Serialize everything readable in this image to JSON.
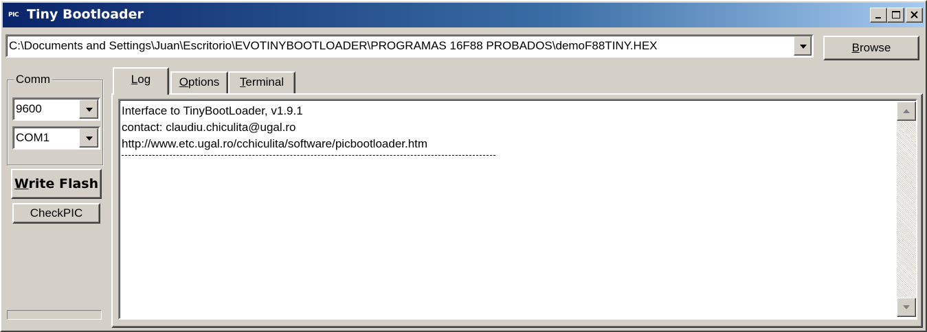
{
  "window": {
    "icon_text": "PIC",
    "title": "Tiny Bootloader"
  },
  "file": {
    "path": "C:\\Documents and Settings\\Juan\\Escritorio\\EVOTINYBOOTLOADER\\PROGRAMAS 16F88 PROBADOS\\demoF88TINY.HEX",
    "browse_label_prefix": "",
    "browse_label_accel": "B",
    "browse_label_rest": "rowse"
  },
  "comm": {
    "legend": "Comm",
    "baud": "9600",
    "port": "COM1"
  },
  "buttons": {
    "write_flash_accel": "W",
    "write_flash_rest": "rite Flash",
    "check_pic": "CheckPIC"
  },
  "tabs": [
    {
      "accel": "L",
      "rest": "og",
      "active": true
    },
    {
      "accel": "O",
      "rest": "ptions",
      "active": false
    },
    {
      "accel": "T",
      "rest": "erminal",
      "active": false
    }
  ],
  "log": {
    "lines": [
      "Interface to TinyBootLoader, v1.9.1",
      "contact: claudiu.chiculita@ugal.ro",
      "http://www.etc.ugal.ro/cchiculita/software/picbootloader.htm"
    ]
  },
  "icons": {
    "minimize": "minimize-icon",
    "maximize": "maximize-icon",
    "close": "close-icon",
    "dropdown": "chevron-down-icon"
  }
}
